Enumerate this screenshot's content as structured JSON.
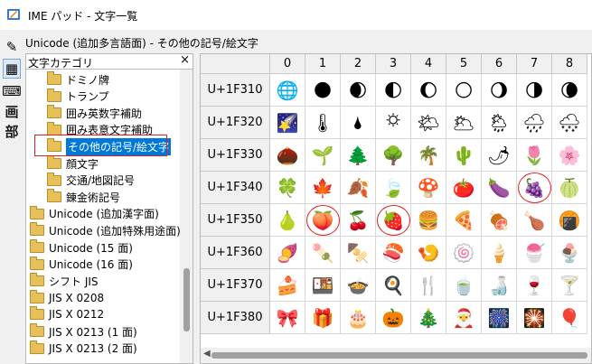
{
  "window": {
    "title": "IME パッド - 文字一覧"
  },
  "toolbar": {
    "items": [
      {
        "name": "handwriting-tool-icon",
        "glyph": "✎"
      },
      {
        "name": "character-list-tool-icon",
        "glyph": "▦"
      },
      {
        "name": "soft-keyboard-tool-icon",
        "glyph": "⌨"
      },
      {
        "name": "total-strokes-tool",
        "glyph": "画"
      },
      {
        "name": "radical-tool",
        "glyph": "部"
      }
    ]
  },
  "category_path": "Unicode (追加多言語面) - その他の記号/絵文字",
  "panel": {
    "title": "文字カテゴリ",
    "close": "×"
  },
  "tree": [
    {
      "label": "ドミノ牌",
      "indent": 1
    },
    {
      "label": "トランプ",
      "indent": 1
    },
    {
      "label": "囲み英数字補助",
      "indent": 1
    },
    {
      "label": "囲み表意文字補助",
      "indent": 1
    },
    {
      "label": "その他の記号/絵文字",
      "indent": 1,
      "selected": true
    },
    {
      "label": "顔文字",
      "indent": 1
    },
    {
      "label": "交通/地図記号",
      "indent": 1
    },
    {
      "label": "錬金術記号",
      "indent": 1
    },
    {
      "label": "Unicode (追加漢字面)",
      "indent": 0
    },
    {
      "label": "Unicode (追加特殊用途面)",
      "indent": 0
    },
    {
      "label": "Unicode (15 面)",
      "indent": 0
    },
    {
      "label": "Unicode (16 面)",
      "indent": 0
    },
    {
      "label": "シフト JIS",
      "indent": 0
    },
    {
      "label": "JIS X 0208",
      "indent": 0
    },
    {
      "label": "JIS X 0212",
      "indent": 0
    },
    {
      "label": "JIS X 0213 (1 面)",
      "indent": 0
    },
    {
      "label": "JIS X 0213 (2 面)",
      "indent": 0
    }
  ],
  "grid": {
    "columns": [
      "0",
      "1",
      "2",
      "3",
      "4",
      "5",
      "6",
      "7",
      "8"
    ],
    "rows": [
      {
        "label": "U+1F310",
        "chars": [
          "🌐",
          "🌑",
          "🌒",
          "🌓",
          "🌔",
          "🌕",
          "🌖",
          "🌗",
          "🌘"
        ]
      },
      {
        "label": "U+1F320",
        "chars": [
          "🌠",
          "🌡",
          "🌢",
          "🌣",
          "🌤",
          "🌥",
          "🌦",
          "🌧",
          "🌨"
        ]
      },
      {
        "label": "U+1F330",
        "chars": [
          "🌰",
          "🌱",
          "🌲",
          "🌳",
          "🌴",
          "🌵",
          "🌶",
          "🌷",
          "🌸"
        ]
      },
      {
        "label": "U+1F340",
        "chars": [
          "🍀",
          "🍁",
          "🍂",
          "🍃",
          "🍄",
          "🍅",
          "🍆",
          "🍇",
          "🍈"
        ]
      },
      {
        "label": "U+1F350",
        "chars": [
          "🍐",
          "🍑",
          "🍒",
          "🍓",
          "🍔",
          "🍕",
          "🍖",
          "🍗",
          "🍘"
        ]
      },
      {
        "label": "U+1F360",
        "chars": [
          "🍠",
          "🍡",
          "🍢",
          "🍣",
          "🍤",
          "🍥",
          "🍦",
          "🍧",
          "🍨"
        ]
      },
      {
        "label": "U+1F370",
        "chars": [
          "🍰",
          "🍱",
          "🍲",
          "🍳",
          "🍴",
          "🍵",
          "🍶",
          "🍷",
          "🍸"
        ]
      },
      {
        "label": "U+1F380",
        "chars": [
          "🎀",
          "🎁",
          "🎂",
          "🎃",
          "🎄",
          "🎅",
          "🎆",
          "🎇",
          "🎈"
        ]
      }
    ]
  },
  "highlight_color": "#e02020",
  "selection_color": "#0078d7"
}
